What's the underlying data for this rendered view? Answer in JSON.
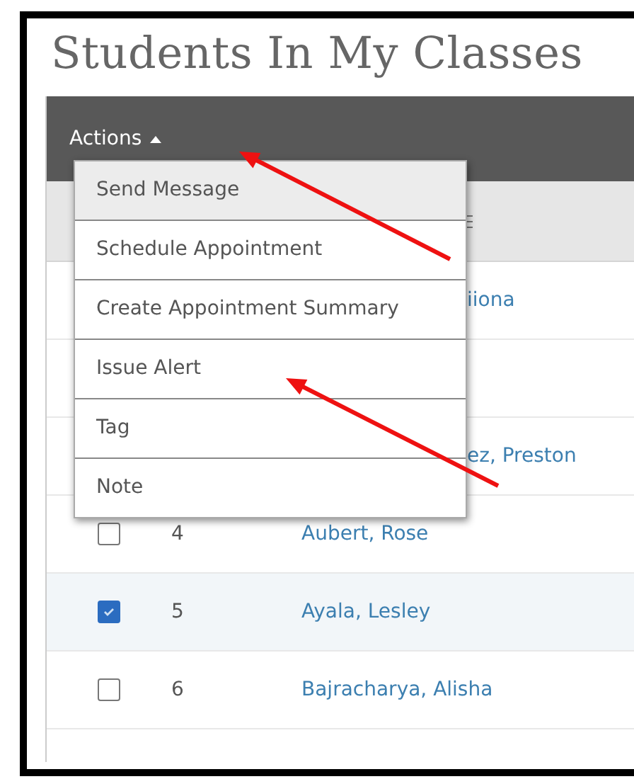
{
  "title": "Students In My Classes",
  "actions_button": {
    "label": "Actions",
    "expanded": true
  },
  "actions_menu": [
    {
      "label": "Send Message",
      "selected": true
    },
    {
      "label": "Schedule Appointment",
      "selected": false
    },
    {
      "label": "Create Appointment Summary",
      "selected": false
    },
    {
      "label": "Issue Alert",
      "selected": false
    },
    {
      "label": "Tag",
      "selected": false
    },
    {
      "label": "Note",
      "selected": false
    }
  ],
  "table": {
    "rows": [
      {
        "name": "iiona"
      },
      {},
      {
        "name": "ez, Preston"
      },
      {
        "checked": false,
        "number": "4",
        "name": "Aubert, Rose"
      },
      {
        "checked": true,
        "number": "5",
        "name": "Ayala, Lesley"
      },
      {
        "checked": false,
        "number": "6",
        "name": "Bajracharya, Alisha"
      }
    ]
  },
  "annotations": [
    {
      "kind": "arrow"
    },
    {
      "kind": "arrow"
    }
  ]
}
